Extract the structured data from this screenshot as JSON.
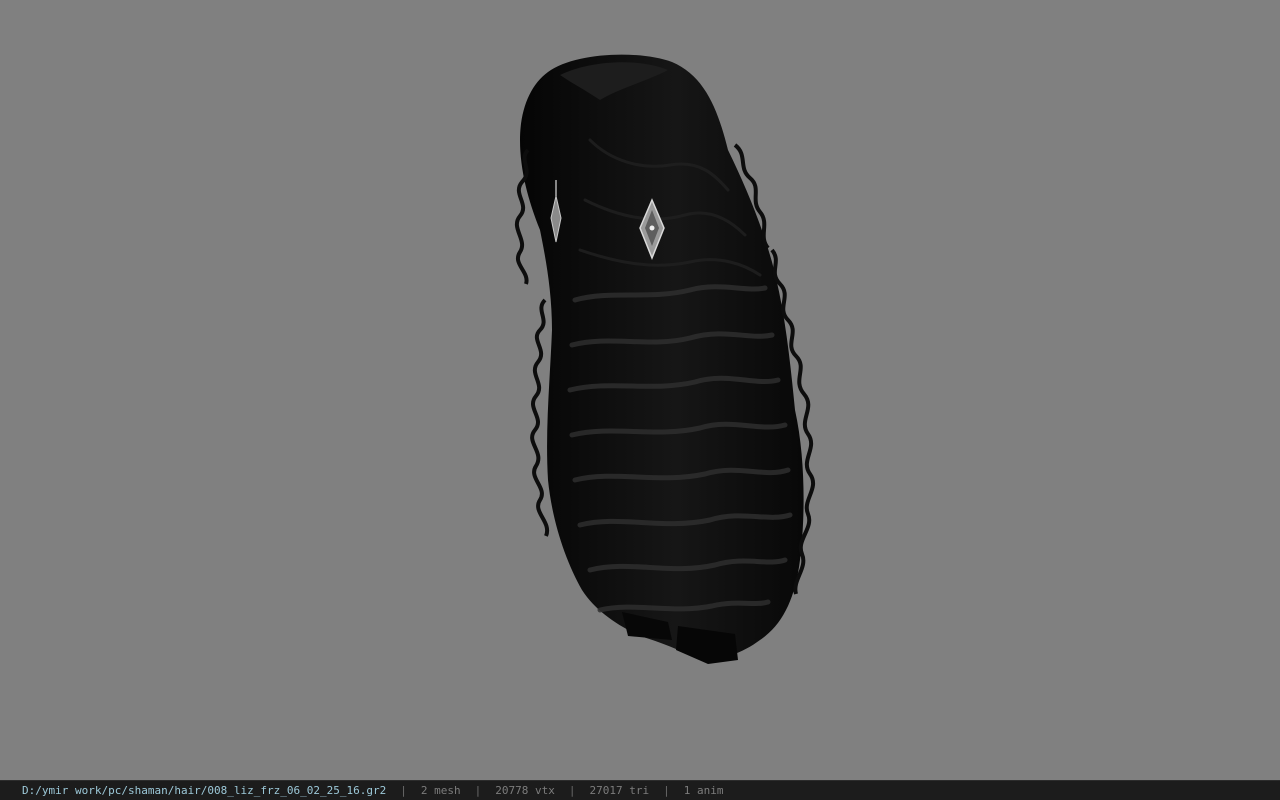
{
  "viewport": {
    "background_color": "#808080",
    "model": {
      "icon": "hair-model-icon",
      "hair_color": "#0b0b0b",
      "accessory_icon": "earring-icon"
    }
  },
  "status_bar": {
    "file_path": "D:/ymir work/pc/shaman/hair/008_liz_frz_06_02_25_16.gr2",
    "separator": "|",
    "mesh": "2 mesh",
    "vertices": "20778 vtx",
    "triangles": "27017 tri",
    "animations": "1 anim"
  }
}
